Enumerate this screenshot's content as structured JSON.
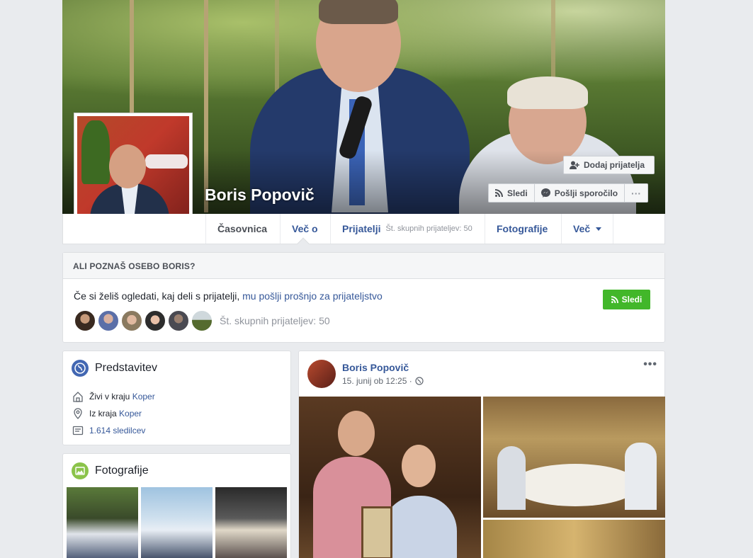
{
  "profile": {
    "name": "Boris Popovič"
  },
  "cover_actions": {
    "add_friend": "Dodaj prijatelja",
    "follow": "Sledi",
    "message": "Pošlji sporočilo",
    "more": "···"
  },
  "nav": {
    "tabs": [
      {
        "label": "Časovnica"
      },
      {
        "label": "Več o"
      },
      {
        "label": "Prijatelji",
        "sub": "Št. skupnih prijateljev: 50"
      },
      {
        "label": "Fotografije"
      },
      {
        "label": "Več"
      }
    ]
  },
  "know_card": {
    "header": "ALI POZNAŠ OSEBO BORIS?",
    "text": "Če si želiš ogledati, kaj deli s prijatelji, ",
    "link": "mu pošlji prošnjo za prijateljstvo",
    "follow": "Sledi",
    "mutual": "Št. skupnih prijateljev: 50"
  },
  "intro": {
    "title": "Predstavitev",
    "lives_prefix": "Živi v kraju ",
    "lives_place": "Koper",
    "from_prefix": "Iz kraja ",
    "from_place": "Koper",
    "followers": "1.614 sledilcev"
  },
  "photos": {
    "title": "Fotografije"
  },
  "post": {
    "author": "Boris Popovič",
    "date": "15. junij ob 12:25 ·",
    "dots": "•••"
  },
  "colors": {
    "link": "#365899",
    "follow_green": "#42b72a",
    "intro_icon": "#4267b2",
    "photos_icon": "#8bc34a"
  }
}
